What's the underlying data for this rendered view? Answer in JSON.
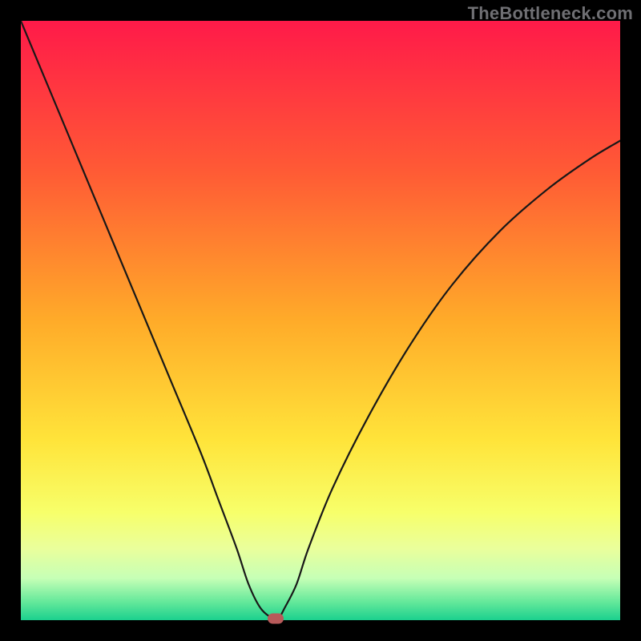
{
  "watermark": "TheBottleneck.com",
  "chart_data": {
    "type": "line",
    "title": "",
    "xlabel": "",
    "ylabel": "",
    "xlim": [
      0,
      100
    ],
    "ylim": [
      0,
      100
    ],
    "grid": false,
    "series": [
      {
        "name": "bottleneck-curve",
        "x": [
          0,
          5,
          10,
          15,
          20,
          25,
          30,
          33,
          36,
          38,
          40,
          42,
          43,
          44,
          46,
          48,
          52,
          58,
          65,
          72,
          80,
          88,
          95,
          100
        ],
        "y": [
          100,
          88,
          76,
          64,
          52,
          40,
          28,
          20,
          12,
          6,
          2,
          0.3,
          0.3,
          2,
          6,
          12,
          22,
          34,
          46,
          56,
          65,
          72,
          77,
          80
        ]
      }
    ],
    "annotations": [
      {
        "name": "optimal-point-marker",
        "x": 42.5,
        "y": 0.3
      }
    ],
    "colors": {
      "gradient_top": "#ff1a49",
      "gradient_bottom": "#1bd08e",
      "curve": "#181818",
      "marker": "#b85a5a",
      "frame": "#000000"
    }
  }
}
